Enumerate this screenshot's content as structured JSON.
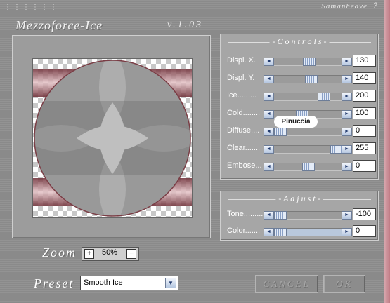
{
  "window": {
    "grip": "⋮⋮⋮⋮⋮⋮",
    "brand": "Samanheave",
    "help_glyph": "?",
    "title": "Mezzoforce-Ice",
    "version": "v.1.03"
  },
  "controls": {
    "heading": "- C o n t r o l s -",
    "rows": [
      {
        "label": "Displ. X.",
        "value": "130",
        "level": 0.51
      },
      {
        "label": "Displ. Y.",
        "value": "140",
        "level": 0.55
      },
      {
        "label": "Ice.........",
        "value": "200",
        "level": 0.78
      },
      {
        "label": "Cold........",
        "value": "100",
        "level": 0.39
      },
      {
        "label": "Diffuse....",
        "value": "0",
        "level": 0.0
      },
      {
        "label": "Clear.......",
        "value": "255",
        "level": 1.0
      },
      {
        "label": "Embose...",
        "value": "0",
        "level": 0.5
      }
    ]
  },
  "adjust": {
    "heading": "- A d j u s t -",
    "rows": [
      {
        "label": "Tone.........",
        "value": "-100",
        "level": 0.0
      },
      {
        "label": "Color.......",
        "value": "0",
        "level": 0.0
      }
    ]
  },
  "watermark": "Pinuccia",
  "zoom": {
    "label": "Zoom",
    "minus": "−",
    "plus": "+",
    "value": "50%"
  },
  "preset": {
    "label": "Preset",
    "selected": "Smooth Ice"
  },
  "buttons": {
    "cancel": "CANCEL",
    "ok": "OK"
  },
  "icons": {
    "left_arrow": "◄",
    "right_arrow": "►",
    "dropdown": "▼"
  },
  "colors": {
    "panel": "#a6a6a6",
    "slider_thumb": "#8aa0c6",
    "accent_edge": "#c07c86"
  }
}
